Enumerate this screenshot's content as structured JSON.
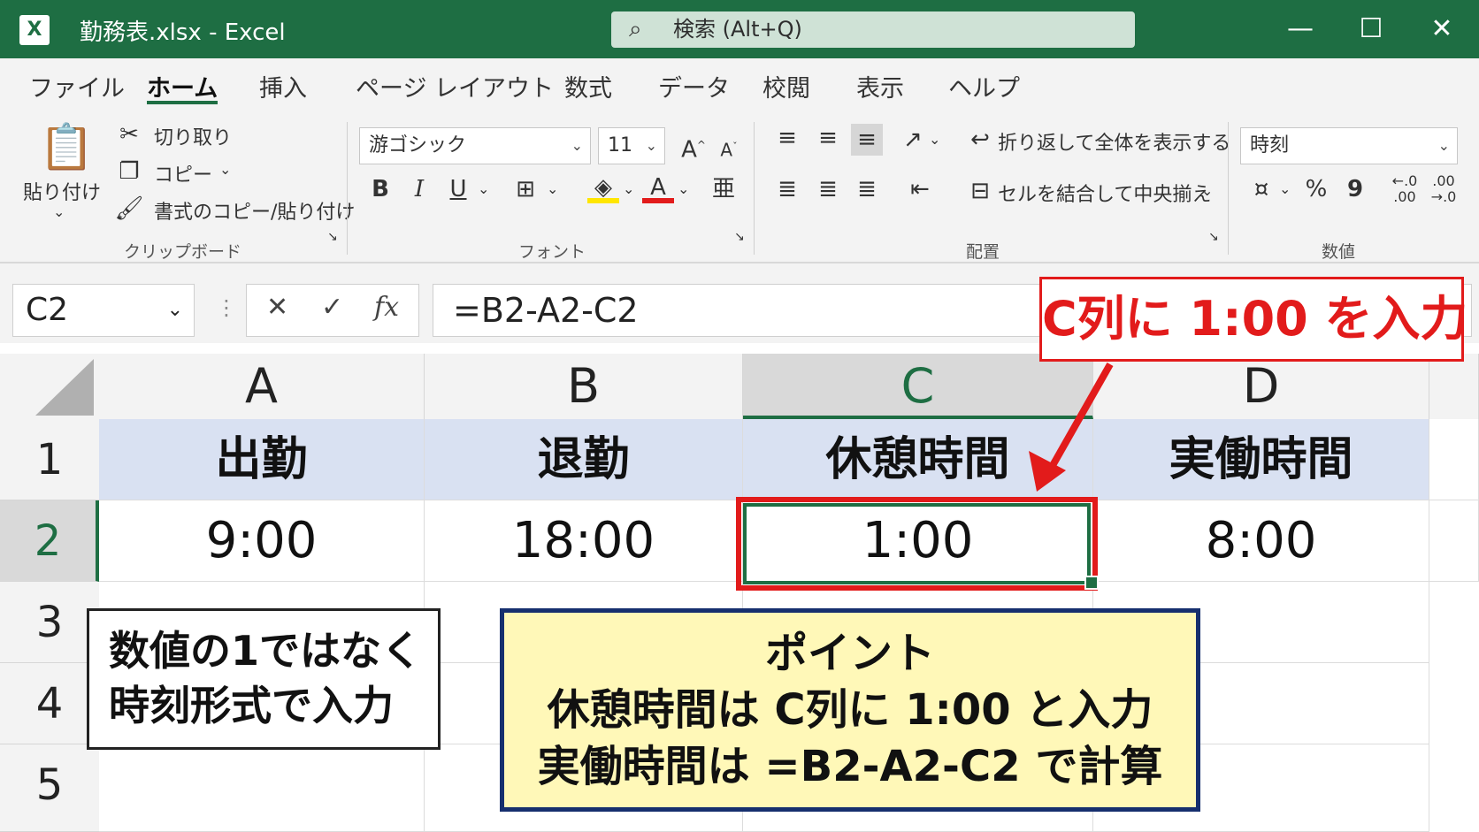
{
  "titlebar": {
    "app_logo": "X",
    "file_title": "勤務表.xlsx  -  Excel",
    "search_placeholder": "検索 (Alt+Q)",
    "search_icon": "search-icon",
    "minimize": "—",
    "maximize": "☐",
    "close": "✕"
  },
  "ribbon_tabs": [
    "ファイル",
    "ホーム",
    "挿入",
    "ページ レイアウト",
    "数式",
    "データ",
    "校閲",
    "表示",
    "ヘルプ"
  ],
  "active_tab": "ホーム",
  "clipboard": {
    "paste": "貼り付け",
    "cut": "切り取り",
    "copy": "コピー",
    "format_painter": "書式のコピー/貼り付け",
    "group_label": "クリップボード"
  },
  "font": {
    "font_name": "游ゴシック",
    "font_size": "11",
    "grow": "A",
    "shrink": "A",
    "bold": "B",
    "italic": "I",
    "underline": "U",
    "group_label": "フォント"
  },
  "alignment": {
    "wrap_text": "折り返して全体を表示する",
    "merge_center": "セルを結合して中央揃え",
    "group_label": "配置"
  },
  "number": {
    "format": "時刻",
    "percent": "%",
    "comma": "9",
    "group_label": "数値"
  },
  "formula_bar": {
    "name_box": "C2",
    "cancel": "✕",
    "enter": "✓",
    "fx": "fx",
    "formula": "=B2-A2-C2"
  },
  "grid": {
    "columns": [
      "A",
      "B",
      "C",
      "D"
    ],
    "rows": [
      "1",
      "2",
      "3",
      "4",
      "5"
    ],
    "row1": [
      "出勤",
      "退勤",
      "休憩時間",
      "実働時間"
    ],
    "row2": [
      "9:00",
      "18:00",
      "1:00",
      "8:00"
    ],
    "selected_cell": "C2"
  },
  "annotations": {
    "top_callout": "C列に 1:00 を入力",
    "left_callout_line1": "数値の1ではなく",
    "left_callout_line2": "時刻形式で入力",
    "point_title": "ポイント",
    "point_line1": "休憩時間は C列に 1:00 と入力",
    "point_line2": "実働時間は =B2-A2-C2 で計算"
  },
  "colors": {
    "excel_green": "#1e6e43",
    "header_fill": "#d9e1f2",
    "callout_red": "#e21b1b",
    "point_fill": "#fff8b8",
    "point_border": "#162f6e"
  }
}
